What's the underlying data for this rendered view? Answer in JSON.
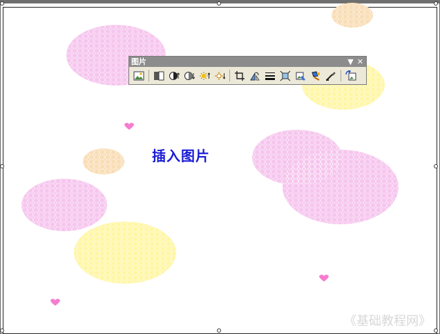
{
  "canvas": {
    "title": "插入图片",
    "watermark": "《基础教程网》"
  },
  "toolbar": {
    "title": "图片",
    "menu_glyph": "▼",
    "close_glyph": "✕",
    "buttons": [
      "insert-picture-icon",
      "color-icon",
      "more-contrast-icon",
      "less-contrast-icon",
      "more-brightness-icon",
      "less-brightness-icon",
      "crop-icon",
      "rotate-left-icon",
      "line-style-icon",
      "compress-pictures-icon",
      "recolor-picture-icon",
      "format-picture-icon",
      "set-transparent-color-icon",
      "reset-picture-icon"
    ]
  },
  "colors": {
    "canvas_title": "#1a1ad6",
    "toolbar_title_bg": "#8c8c8c",
    "toolbar_bg": "#ece9d8",
    "pink": "#f6c6ee",
    "yellow": "#fff6a6",
    "peach": "#f9ddb6",
    "heart": "#f57dcf"
  }
}
